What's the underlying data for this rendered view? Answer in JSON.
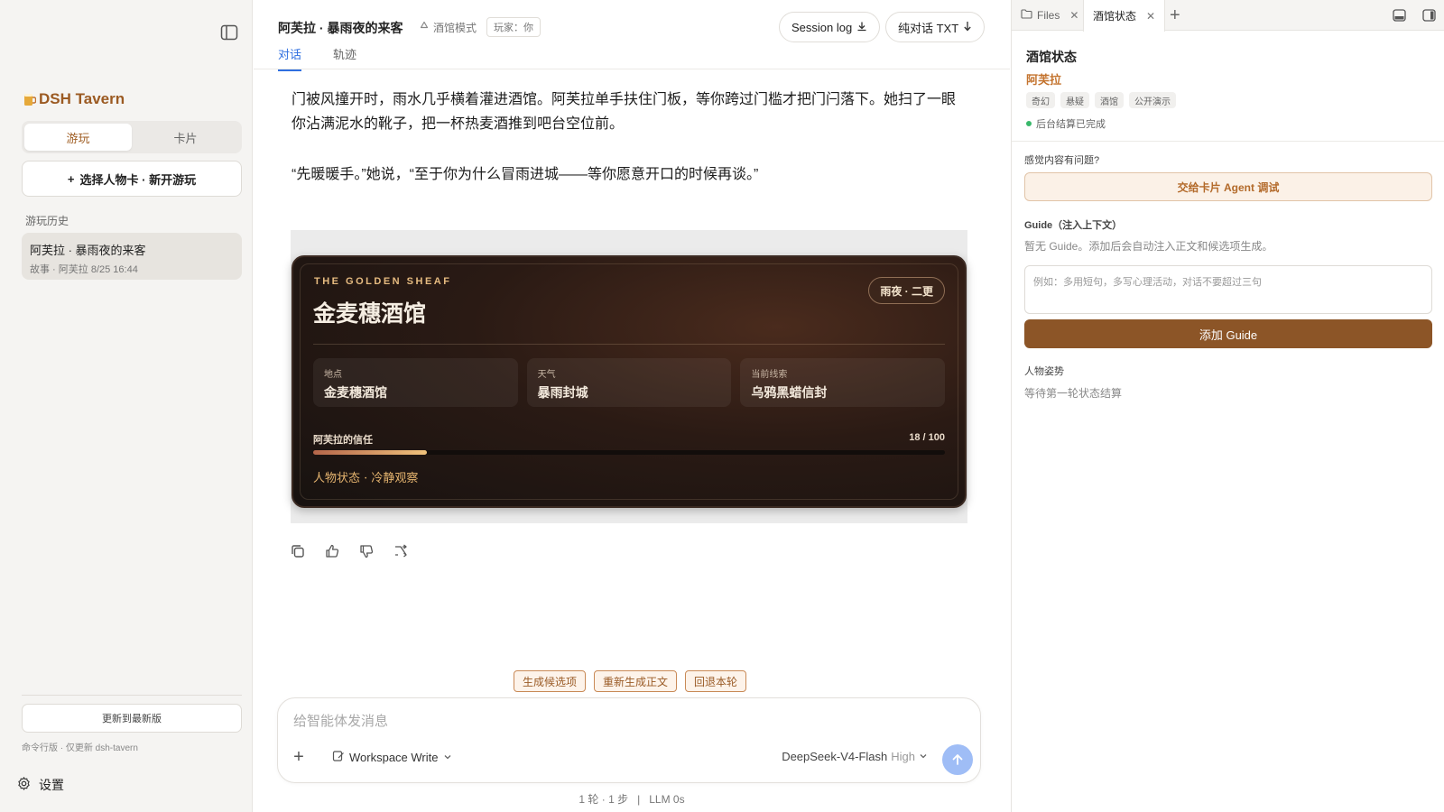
{
  "sidebar": {
    "brand": "DSH Tavern",
    "seg": [
      "游玩",
      "卡片"
    ],
    "new_game": "选择人物卡 · 新开游玩",
    "history_title": "游玩历史",
    "history": [
      {
        "title": "阿芙拉 · 暴雨夜的来客",
        "sub": "故事 · 阿芙拉  8/25 16:44"
      }
    ],
    "update": "更新到最新版",
    "update_note": "命令行版 · 仅更新 dsh-tavern",
    "settings": "设置"
  },
  "header": {
    "title": "阿芙拉 · 暴雨夜的来客",
    "mode": "酒馆模式",
    "player": "玩家：你",
    "session_log": "Session log",
    "txt": "纯对话 TXT",
    "tabs": [
      "对话",
      "轨迹"
    ]
  },
  "story": {
    "p1": "门被风撞开时，雨水几乎横着灌进酒馆。阿芙拉单手扶住门板，等你跨过门槛才把门闩落下。她扫了一眼你沾满泥水的靴子，把一杯热麦酒推到吧台空位前。",
    "p2": "“先暖暖手。”她说，“至于你为什么冒雨进城——等你愿意开口的时候再谈。”"
  },
  "card": {
    "kicker": "THE GOLDEN SHEAF",
    "title": "金麦穗酒馆",
    "badge": "雨夜 · 二更",
    "cells": [
      {
        "k": "地点",
        "v": "金麦穗酒馆"
      },
      {
        "k": "天气",
        "v": "暴雨封城"
      },
      {
        "k": "当前线索",
        "v": "乌鸦黑蜡信封"
      }
    ],
    "trust_label": "阿芙拉的信任",
    "trust_text": "18 / 100",
    "trust_value": 18,
    "trust_max": 100,
    "status": "人物状态 · 冷静观察"
  },
  "chips": [
    "生成候选项",
    "重新生成正文",
    "回退本轮"
  ],
  "composer": {
    "placeholder": "给智能体发消息",
    "workspace": "Workspace Write",
    "model": "DeepSeek-V4-Flash",
    "effort": "High"
  },
  "footer": {
    "stat": "1 轮 · 1 步   |   LLM 0s"
  },
  "right": {
    "tabs": [
      "Files",
      "酒馆状态"
    ],
    "title": "酒馆状态",
    "char": "阿芙拉",
    "tags": [
      "奇幻",
      "悬疑",
      "酒馆",
      "公开演示"
    ],
    "done": "后台结算已完成",
    "question": "感觉内容有问题?",
    "debug": "交给卡片 Agent 调试",
    "guide_label": "Guide（注入上下文）",
    "guide_desc": "暂无 Guide。添加后会自动注入正文和候选项生成。",
    "guide_placeholder": "例如：多用短句，多写心理活动，对话不要超过三句",
    "add_guide": "添加 Guide",
    "pose_label": "人物姿势",
    "pose_desc": "等待第一轮状态结算"
  },
  "colors": {
    "accent": "#9b5a22",
    "tab_active": "#2f6fe0",
    "send": "#9fbdf6",
    "guide_btn": "#8c5527"
  }
}
